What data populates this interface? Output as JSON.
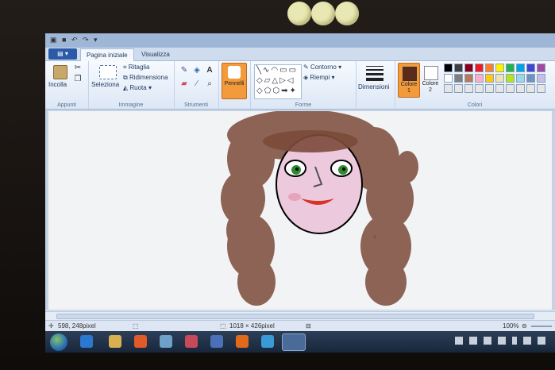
{
  "qat": {
    "text": "▣ ■ ↶ ↷ ▾"
  },
  "tabs": {
    "file": "▤ ▾",
    "home": "Pagina iniziale",
    "view": "Visualizza"
  },
  "ribbon": {
    "clipboard": {
      "paste": "Incolla",
      "group": "Appunti"
    },
    "image": {
      "select": "Seleziona",
      "crop": "Ritaglia",
      "resize": "Ridimensiona",
      "rotate": "Ruota",
      "group": "Immagine"
    },
    "tools": {
      "group": "Strumenti",
      "text_tool": "A"
    },
    "brushes": {
      "label": "Pennelli"
    },
    "shapes": {
      "outline": "Contorno",
      "fill": "Riempi",
      "group": "Forme"
    },
    "size": {
      "label": "Dimensioni"
    },
    "colors": {
      "color1": "Colore 1",
      "color2": "Colore 2",
      "group": "Colori",
      "color1_value": "#5a2a1a",
      "color2_value": "#ffffff",
      "palette": [
        "#000000",
        "#3f3f3f",
        "#880015",
        "#ed1c24",
        "#ff7f27",
        "#fff200",
        "#22b14c",
        "#00a2e8",
        "#3f48cc",
        "#a349a4",
        "#ffffff",
        "#7f7f7f",
        "#b97a57",
        "#ffaec9",
        "#ffc90e",
        "#efe4b0",
        "#b5e61d",
        "#99d9ea",
        "#7092be",
        "#c8bfe7",
        "#e6e6e6",
        "#e6e6e6",
        "#e6e6e6",
        "#e6e6e6",
        "#e6e6e6",
        "#e6e6e6",
        "#e6e6e6",
        "#e6e6e6",
        "#e6e6e6",
        "#e6e6e6"
      ]
    }
  },
  "drawing": {
    "hair_color": "#7b4a3a",
    "skin_color": "#ecc9dc",
    "iris_color": "#2f8a2f",
    "lips_color": "#d8332b"
  },
  "status": {
    "cursor_pos": "598, 248pixel",
    "canvas_size": "1018 × 426pixel",
    "zoom": "100%"
  }
}
